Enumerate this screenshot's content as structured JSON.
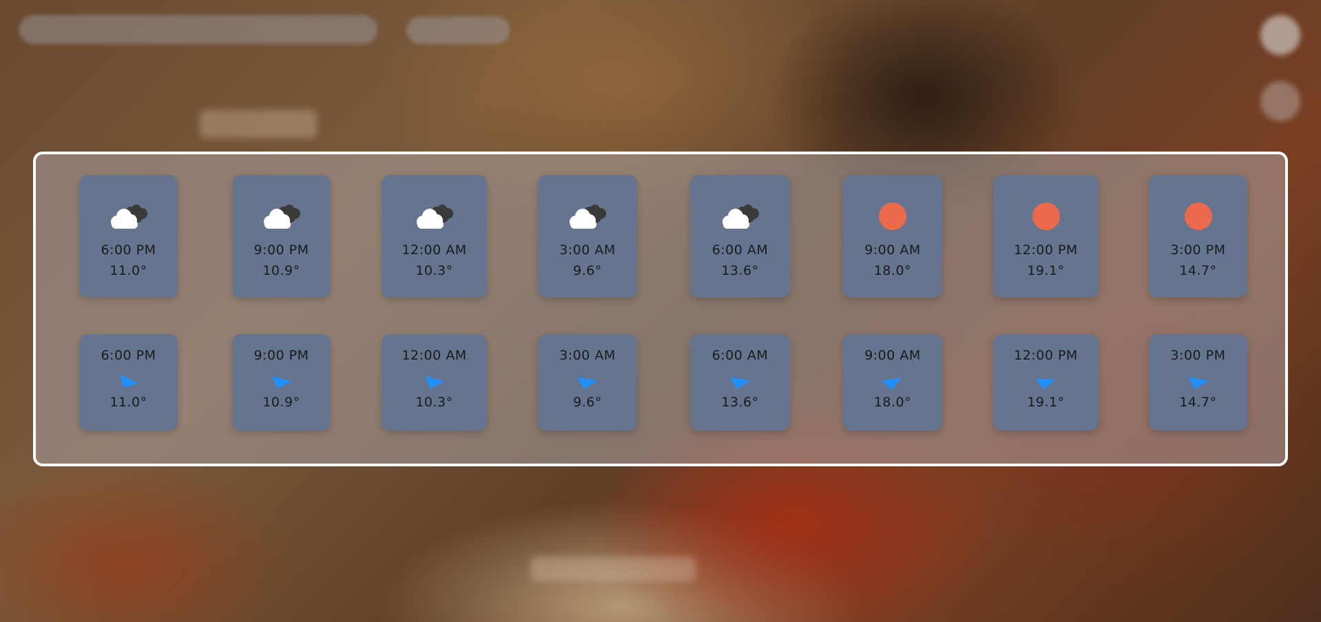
{
  "colors": {
    "card_bg": "#65748f",
    "panel_border": "#ffffff",
    "sun": "#ec6a4c",
    "wind_arrow": "#1e90ff",
    "cloud_front": "#ffffff",
    "cloud_back": "#3a3a3a"
  },
  "forecast": [
    {
      "time": "6:00 PM",
      "temp": "11.0°",
      "icon": "partly-cloudy-icon"
    },
    {
      "time": "9:00 PM",
      "temp": "10.9°",
      "icon": "partly-cloudy-icon"
    },
    {
      "time": "12:00 AM",
      "temp": "10.3°",
      "icon": "partly-cloudy-icon"
    },
    {
      "time": "3:00 AM",
      "temp": "9.6°",
      "icon": "partly-cloudy-icon"
    },
    {
      "time": "6:00 AM",
      "temp": "13.6°",
      "icon": "partly-cloudy-icon"
    },
    {
      "time": "9:00 AM",
      "temp": "18.0°",
      "icon": "sun-icon"
    },
    {
      "time": "12:00 PM",
      "temp": "19.1°",
      "icon": "sun-icon"
    },
    {
      "time": "3:00 PM",
      "temp": "14.7°",
      "icon": "sun-icon"
    }
  ],
  "wind": [
    {
      "time": "6:00 PM",
      "temp": "11.0°",
      "icon": "wind-direction-icon"
    },
    {
      "time": "9:00 PM",
      "temp": "10.9°",
      "icon": "wind-direction-icon"
    },
    {
      "time": "12:00 AM",
      "temp": "10.3°",
      "icon": "wind-direction-icon"
    },
    {
      "time": "3:00 AM",
      "temp": "9.6°",
      "icon": "wind-direction-icon"
    },
    {
      "time": "6:00 AM",
      "temp": "13.6°",
      "icon": "wind-direction-icon"
    },
    {
      "time": "9:00 AM",
      "temp": "18.0°",
      "icon": "wind-direction-icon"
    },
    {
      "time": "12:00 PM",
      "temp": "19.1°",
      "icon": "wind-direction-icon"
    },
    {
      "time": "3:00 PM",
      "temp": "14.7°",
      "icon": "wind-direction-icon"
    }
  ]
}
